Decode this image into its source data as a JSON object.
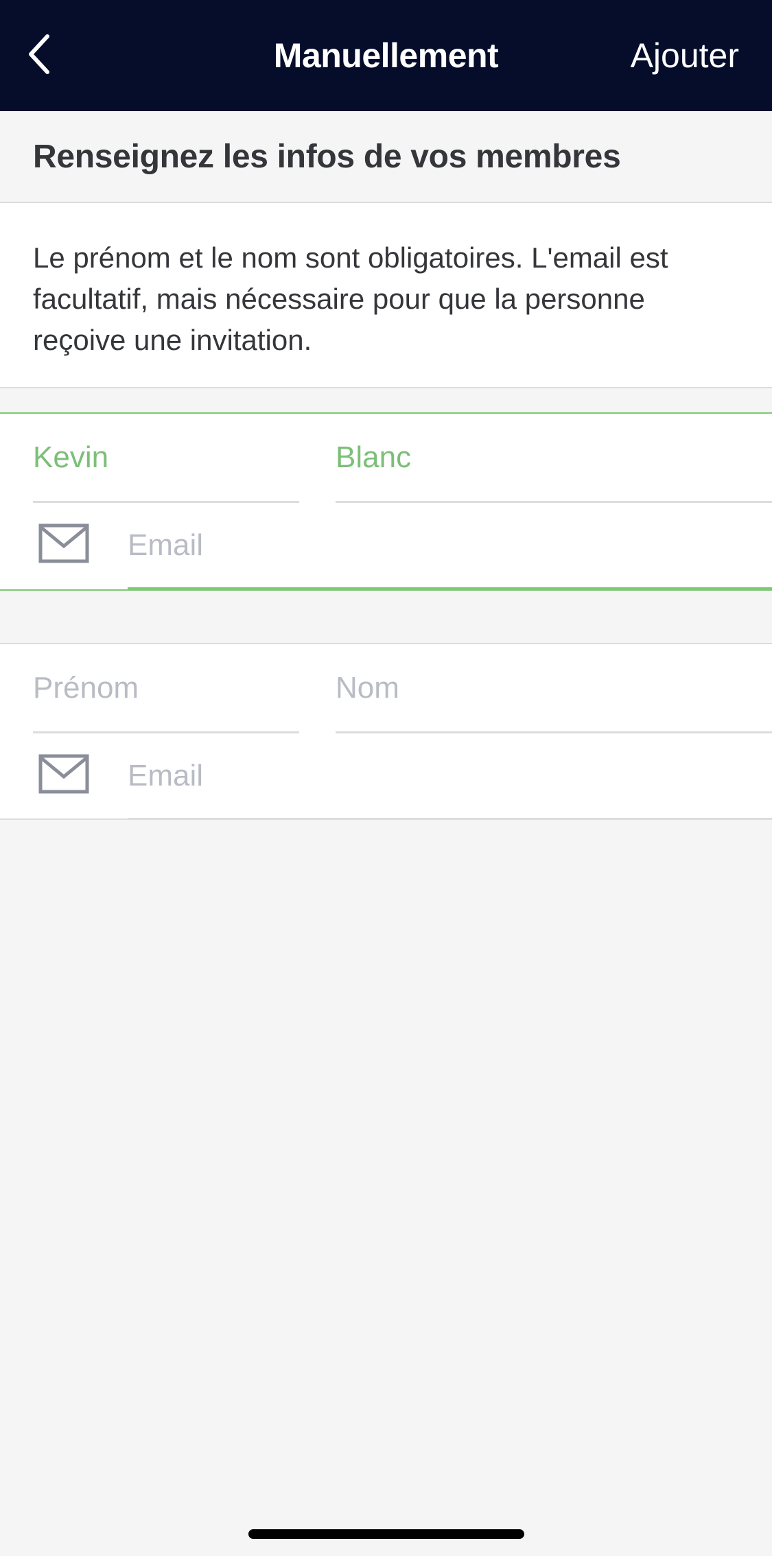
{
  "colors": {
    "navbar_bg": "#050d2b",
    "accent_green": "#7cc875",
    "filled_text": "#7cbf78",
    "placeholder": "#b9bcc4",
    "body_text": "#35363a",
    "background": "#f5f5f6"
  },
  "navbar": {
    "back_icon": "chevron-left-icon",
    "title": "Manuellement",
    "action_label": "Ajouter"
  },
  "section": {
    "title": "Renseignez les infos de vos membres"
  },
  "info": {
    "text": "Le prénom et le nom sont obligatoires. L'email est facultatif, mais nécessaire pour que la personne reçoive une invitation."
  },
  "members": [
    {
      "first_name": "Kevin",
      "last_name": "Blanc",
      "email_icon": "envelope-icon",
      "email_placeholder": "Email",
      "state": "active"
    },
    {
      "first_name_placeholder": "Prénom",
      "last_name_placeholder": "Nom",
      "email_icon": "envelope-icon",
      "email_placeholder": "Email",
      "state": "empty"
    }
  ]
}
